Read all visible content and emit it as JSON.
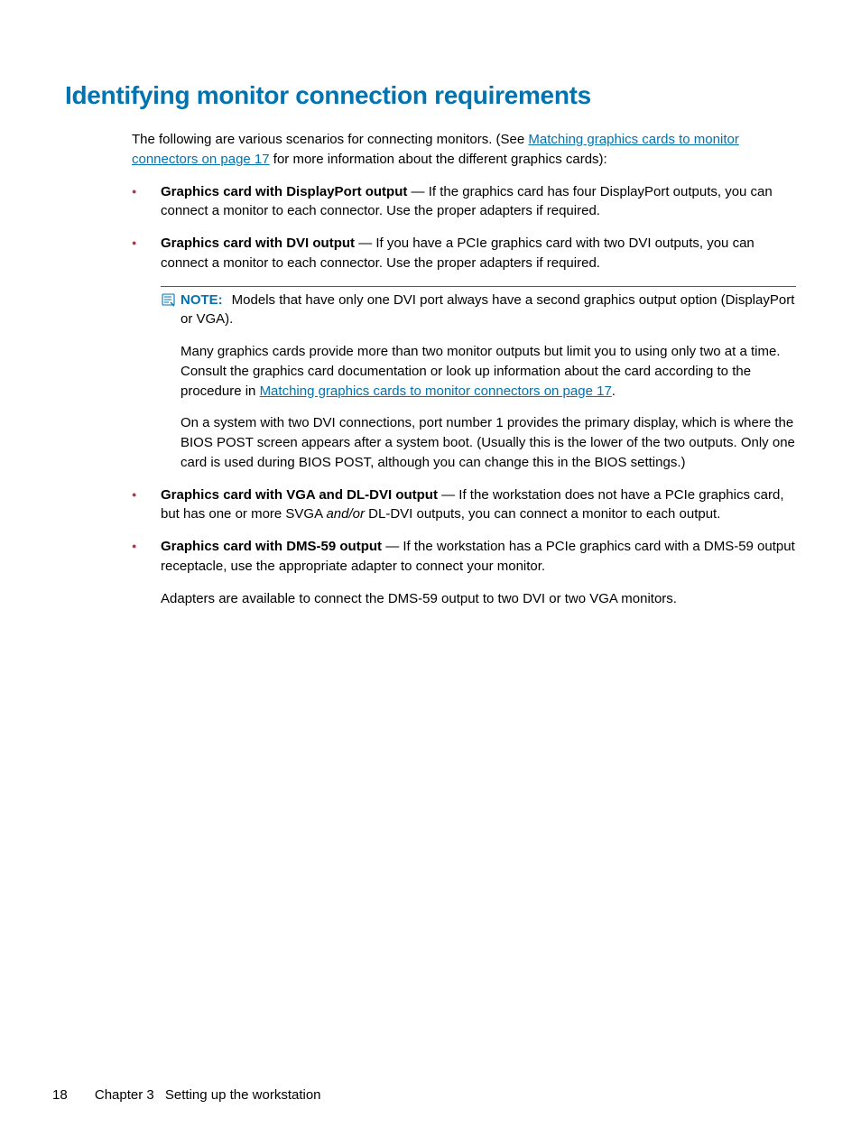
{
  "heading": "Identifying monitor connection requirements",
  "intro": {
    "before_link": "The following are various scenarios for connecting monitors. (See ",
    "link": "Matching graphics cards to monitor connectors on page 17",
    "after_link": " for more information about the different graphics cards):"
  },
  "bullets": {
    "b1": {
      "lead": "Graphics card with DisplayPort output",
      "rest": " — If the graphics card has four DisplayPort outputs, you can connect a monitor to each connector. Use the proper adapters if required."
    },
    "b2": {
      "lead": "Graphics card with DVI output",
      "rest": " — If you have a PCIe graphics card with two DVI outputs, you can connect a monitor to each connector. Use the proper adapters if required."
    },
    "b3": {
      "lead": "Graphics card with VGA and DL-DVI output",
      "rest_a": " — If the workstation does not have a PCIe graphics card, but has one or more SVGA ",
      "italic": "and/or",
      "rest_b": " DL-DVI outputs, you can connect a monitor to each output."
    },
    "b4": {
      "lead": "Graphics card with DMS-59 output",
      "rest": " — If the workstation has a PCIe graphics card with a DMS-59 output receptacle, use the appropriate adapter to connect your monitor.",
      "sub": "Adapters are available to connect the DMS-59 output to two DVI or two VGA monitors."
    }
  },
  "note": {
    "label": "NOTE:",
    "text1": "Models that have only one DVI port always have a second graphics output option (DisplayPort or VGA).",
    "text2a": "Many graphics cards provide more than two monitor outputs but limit you to using only two at a time. Consult the graphics card documentation or look up information about the card according to the procedure in ",
    "link2": "Matching graphics cards to monitor connectors on page 17",
    "text2b": ".",
    "text3": "On a system with two DVI connections, port number 1 provides the primary display, which is where the BIOS POST screen appears after a system boot. (Usually this is the lower of the two outputs. Only one card is used during BIOS POST, although you can change this in the BIOS settings.)"
  },
  "footer": {
    "page": "18",
    "chapter": "Chapter 3",
    "title": "Setting up the workstation"
  }
}
